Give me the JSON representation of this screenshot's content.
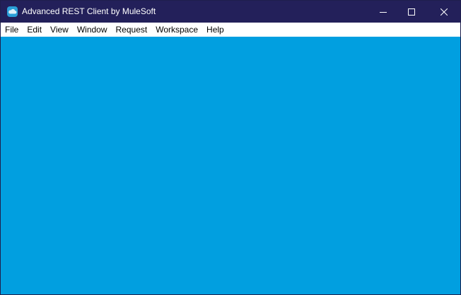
{
  "window": {
    "title": "Advanced REST Client by MuleSoft",
    "icon": "cloud-app-icon",
    "controls": {
      "minimize_icon": "minimize-icon",
      "maximize_icon": "maximize-icon",
      "close_icon": "close-icon"
    }
  },
  "menubar": {
    "items": [
      {
        "label": "File"
      },
      {
        "label": "Edit"
      },
      {
        "label": "View"
      },
      {
        "label": "Window"
      },
      {
        "label": "Request"
      },
      {
        "label": "Workspace"
      },
      {
        "label": "Help"
      }
    ]
  },
  "colors": {
    "titlebar": "#23205a",
    "content_background": "#019fe0",
    "menubar": "#ffffff"
  }
}
